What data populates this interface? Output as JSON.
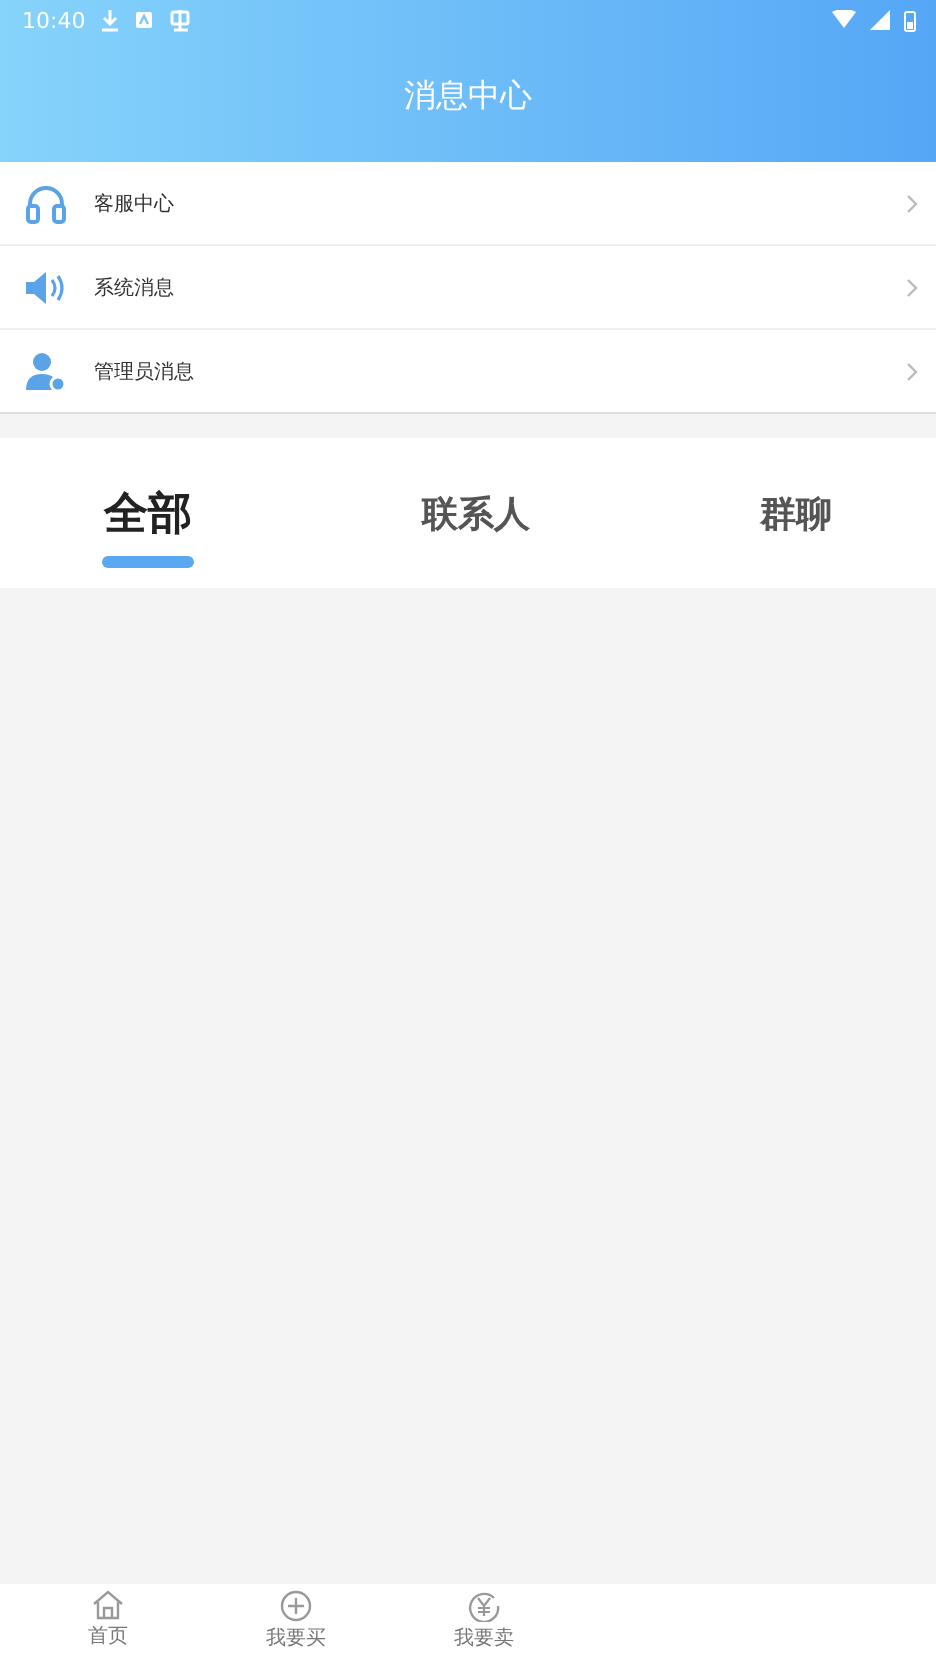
{
  "status_bar": {
    "time": "10:40"
  },
  "header": {
    "title": "消息中心"
  },
  "menu": [
    {
      "kind": "headset",
      "label": "客服中心"
    },
    {
      "kind": "speaker",
      "label": "系统消息"
    },
    {
      "kind": "admin",
      "label": "管理员消息"
    }
  ],
  "tabs": [
    {
      "label": "全部",
      "selected": true
    },
    {
      "label": "联系人",
      "selected": false
    },
    {
      "label": "群聊",
      "selected": false
    }
  ],
  "bottom_nav": [
    {
      "kind": "home",
      "label": "首页"
    },
    {
      "kind": "plus",
      "label": "我要买"
    },
    {
      "kind": "yuan",
      "label": "我要卖"
    }
  ]
}
